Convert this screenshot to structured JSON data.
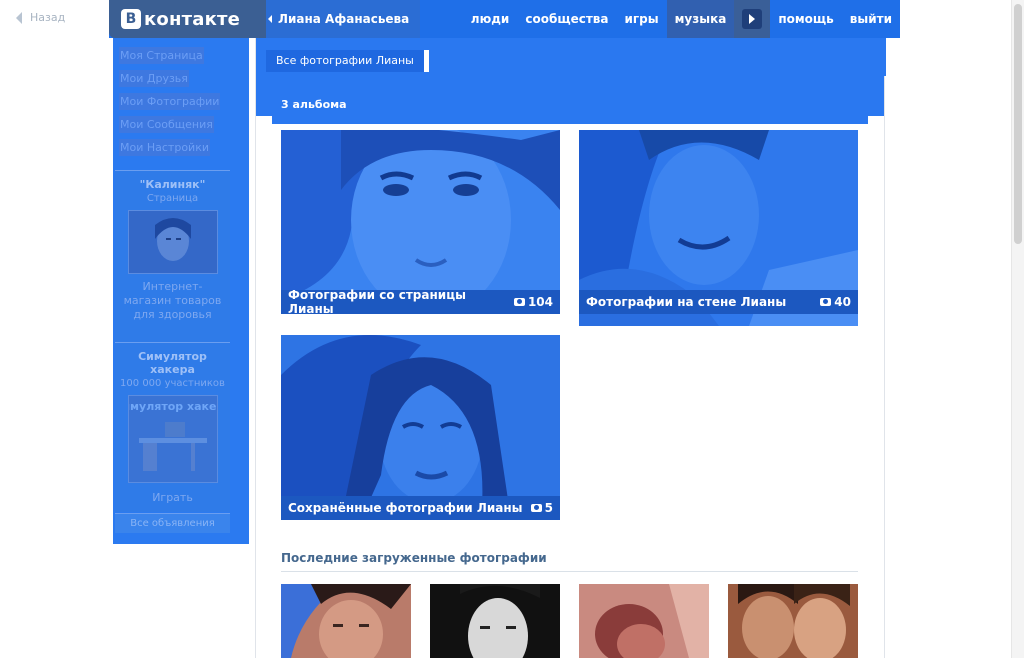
{
  "back_label": "Назад",
  "brand": {
    "logo_letter": "В",
    "logo_text": "контакте"
  },
  "owner_name": "Лиана Афанасьева",
  "nav": [
    {
      "label": "люди"
    },
    {
      "label": "сообщества"
    },
    {
      "label": "игры"
    },
    {
      "label": "музыка"
    },
    {
      "label": "помощь"
    },
    {
      "label": "выйти"
    }
  ],
  "menu": [
    {
      "label": "Моя Страница"
    },
    {
      "label": "Мои Друзья"
    },
    {
      "label": "Мои Фотографии"
    },
    {
      "label": "Мои Сообщения"
    },
    {
      "label": "Мои Настройки"
    }
  ],
  "ads": [
    {
      "title": "\"Калиняк\"",
      "subtitle": "Страница",
      "description": "Интернет-магазин товаров для здоровья",
      "action": ""
    },
    {
      "title": "Симулятор хакера",
      "subtitle": "100 000 участников",
      "description": "",
      "action": "Играть",
      "image_text": "Симулятор хакера"
    }
  ],
  "all_ads": "Все объявления",
  "tab_label": "Все фотографии Лианы",
  "albums_header": "3 альбома",
  "albums": [
    {
      "title": "Фотографии со страницы Лианы",
      "count": "104"
    },
    {
      "title": "Фотографии на стене Лианы",
      "count": "40"
    },
    {
      "title": "Сохранённые фотографии Лианы",
      "count": "5"
    }
  ],
  "latest_header": "Последние загруженные фотографии",
  "colors": {
    "accent": "#1f6fe8",
    "logo_bg": "#3b5f93",
    "caption_bg": "#1c58c0"
  }
}
